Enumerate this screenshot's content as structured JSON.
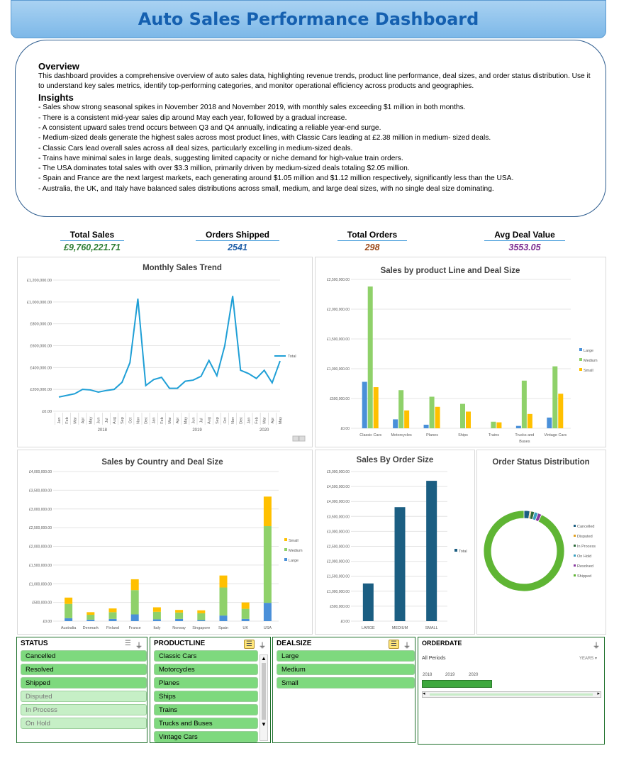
{
  "title": "Auto Sales Performance Dashboard",
  "overview": {
    "heading": "Overview",
    "text": "This dashboard provides a comprehensive overview of auto sales data, highlighting revenue trends, product line performance, deal sizes, and order status distribution. Use it to understand key sales metrics, identify top-performing categories, and monitor operational efficiency across products and geographies.",
    "insights_heading": "Insights",
    "insights": [
      "- Sales show strong seasonal spikes in November 2018 and November 2019, with monthly sales exceeding $1 million in both months.",
      "- There is a consistent mid-year sales dip around May each year, followed by a gradual increase.",
      "- A consistent upward sales trend occurs between Q3 and Q4 annually, indicating a reliable year-end surge.",
      "- Medium-sized deals generate the highest sales across most product lines, with Classic Cars leading at £2.38 million in medium-      sized deals.",
      "- Classic Cars lead overall sales across all deal sizes, particularly excelling in medium-sized deals.",
      "- Trains have minimal sales in large deals, suggesting limited capacity or niche demand for high-value train orders.",
      "- The USA dominates total sales with over $3.3 million, primarily driven by medium-sized deals totaling $2.05 million.",
      "- Spain and France are the next largest markets, each generating around $1.05 million and $1.12 million respectively, significantly less than the USA.",
      "- Australia, the UK, and Italy have balanced sales distributions across small, medium, and large deal sizes, with no single deal size dominating."
    ]
  },
  "kpis": [
    {
      "label": "Total Sales",
      "value": "£9,760,221.71",
      "color": "#2e7d32"
    },
    {
      "label": "Orders Shipped",
      "value": "2541",
      "color": "#1f5fa8"
    },
    {
      "label": "Total Orders",
      "value": "298",
      "color": "#9c4a1a"
    },
    {
      "label": "Avg Deal Value",
      "value": "3553.05",
      "color": "#7b2b8f"
    }
  ],
  "charts": {
    "monthly": {
      "title": "Monthly Sales Trend",
      "legend": "Total",
      "yticks": [
        "£1,200,000.00",
        "£1,000,000.00",
        "£800,000.00",
        "£600,000.00",
        "£400,000.00",
        "£200,000.00",
        "£0.00"
      ],
      "years": [
        "2018",
        "2019",
        "2020"
      ]
    },
    "product": {
      "title": "Sales by product Line and Deal Size",
      "yticks": [
        "£2,500,000.00",
        "£2,000,000.00",
        "£1,500,000.00",
        "£1,000,000.00",
        "£500,000.00",
        "£0.00"
      ]
    },
    "country": {
      "title": "Sales by Country and Deal Size",
      "yticks": [
        "£4,000,000.00",
        "£3,500,000.00",
        "£3,000,000.00",
        "£2,500,000.00",
        "£2,000,000.00",
        "£1,500,000.00",
        "£1,000,000.00",
        "£500,000.00",
        "£0.00"
      ]
    },
    "ordersize": {
      "title": "Sales By Order Size",
      "yticks": [
        "£5,000,000.00",
        "£4,500,000.00",
        "£4,000,000.00",
        "£3,500,000.00",
        "£3,000,000.00",
        "£2,500,000.00",
        "£2,000,000.00",
        "£1,500,000.00",
        "£1,000,000.00",
        "£500,000.00",
        "£0.00"
      ],
      "legend": "Total"
    },
    "status": {
      "title": "Order Status Distribution"
    }
  },
  "colors": {
    "large": "#4a90d9",
    "medium": "#8fd16a",
    "small": "#ffc000",
    "line": "#1f9fd6",
    "total": "#1b5e82"
  },
  "chart_data": [
    {
      "type": "line",
      "title": "Monthly Sales Trend",
      "x": [
        "Jan 2018",
        "Feb 2018",
        "Mar 2018",
        "Apr 2018",
        "May 2018",
        "Jun 2018",
        "Jul 2018",
        "Aug 2018",
        "Sep 2018",
        "Oct 2018",
        "Nov 2018",
        "Dec 2018",
        "Jan 2019",
        "Feb 2019",
        "Mar 2019",
        "Apr 2019",
        "May 2019",
        "Jun 2019",
        "Jul 2019",
        "Aug 2019",
        "Sep 2019",
        "Oct 2019",
        "Nov 2019",
        "Dec 2019",
        "Jan 2020",
        "Feb 2020",
        "Mar 2020",
        "Apr 2020",
        "May 2020"
      ],
      "categories": [
        "Jan",
        "Feb",
        "Mar",
        "Apr",
        "May",
        "Jun",
        "Jul",
        "Aug",
        "Sep",
        "Oct",
        "Nov",
        "Dec",
        "Jan",
        "Feb",
        "Mar",
        "Apr",
        "May",
        "Jun",
        "Jul",
        "Aug",
        "Sep",
        "Oct",
        "Nov",
        "Dec",
        "Jan",
        "Feb",
        "Mar",
        "Apr",
        "May"
      ],
      "series": [
        {
          "name": "Total",
          "values": [
            130000,
            145000,
            160000,
            200000,
            195000,
            175000,
            190000,
            200000,
            265000,
            445000,
            1030000,
            235000,
            290000,
            310000,
            210000,
            210000,
            275000,
            285000,
            320000,
            465000,
            325000,
            600000,
            1055000,
            375000,
            345000,
            300000,
            375000,
            260000,
            460000
          ]
        }
      ],
      "ylim": [
        0,
        1200000
      ]
    },
    {
      "type": "bar",
      "title": "Sales by product Line and Deal Size",
      "categories": [
        "Classic Cars",
        "Motorcycles",
        "Planes",
        "Ships",
        "Trains",
        "Trucks and Buses",
        "Vintage Cars"
      ],
      "series": [
        {
          "name": "Large",
          "values": [
            780000,
            150000,
            60000,
            0,
            0,
            40000,
            180000
          ]
        },
        {
          "name": "Medium",
          "values": [
            2380000,
            640000,
            530000,
            410000,
            110000,
            800000,
            1040000
          ]
        },
        {
          "name": "Small",
          "values": [
            690000,
            300000,
            360000,
            280000,
            100000,
            240000,
            580000
          ]
        }
      ],
      "ylim": [
        0,
        2500000
      ]
    },
    {
      "type": "bar",
      "title": "Sales by Country and Deal Size",
      "categories": [
        "Australia",
        "Denmark",
        "Finland",
        "France",
        "Italy",
        "Norway",
        "Singapore",
        "Spain",
        "UK",
        "USA"
      ],
      "series": [
        {
          "name": "Large",
          "values": [
            80000,
            40000,
            60000,
            180000,
            50000,
            60000,
            30000,
            150000,
            60000,
            490000
          ]
        },
        {
          "name": "Medium",
          "values": [
            380000,
            130000,
            180000,
            650000,
            200000,
            170000,
            180000,
            750000,
            270000,
            2050000
          ]
        },
        {
          "name": "Small",
          "values": [
            170000,
            70000,
            100000,
            290000,
            120000,
            70000,
            80000,
            320000,
            170000,
            790000
          ]
        }
      ],
      "ylim": [
        0,
        4000000
      ]
    },
    {
      "type": "bar",
      "title": "Sales By Order Size",
      "categories": [
        "LARGE",
        "MEDIUM",
        "SMALL"
      ],
      "series": [
        {
          "name": "Total",
          "values": [
            1260000,
            3810000,
            4690000
          ]
        }
      ],
      "ylim": [
        0,
        5000000
      ]
    },
    {
      "type": "pie",
      "title": "Order Status Distribution",
      "categories": [
        "Cancelled",
        "Disputed",
        "In Process",
        "On Hold",
        "Resolved",
        "Shipped"
      ],
      "values": [
        2.3,
        0.5,
        1.4,
        1.5,
        1.5,
        92.8
      ],
      "colors": [
        "#1b5e82",
        "#e0a020",
        "#2e6b3a",
        "#3aa0c0",
        "#8a3aa0",
        "#5fb534"
      ]
    }
  ],
  "slicers": {
    "status": {
      "title": "STATUS",
      "items": [
        {
          "label": "Cancelled",
          "on": true
        },
        {
          "label": "Resolved",
          "on": true
        },
        {
          "label": "Shipped",
          "on": true
        },
        {
          "label": "Disputed",
          "on": false
        },
        {
          "label": "In Process",
          "on": false
        },
        {
          "label": "On Hold",
          "on": false
        }
      ]
    },
    "productline": {
      "title": "PRODUCTLINE",
      "items": [
        "Classic Cars",
        "Motorcycles",
        "Planes",
        "Ships",
        "Trains",
        "Trucks and Buses",
        "Vintage Cars"
      ]
    },
    "dealsize": {
      "title": "DEALSIZE",
      "items": [
        "Large",
        "Medium",
        "Small"
      ]
    },
    "orderdate": {
      "title": "ORDERDATE",
      "period": "All Periods",
      "unit": "YEARS",
      "years": [
        "2018",
        "2019",
        "2020"
      ]
    }
  }
}
